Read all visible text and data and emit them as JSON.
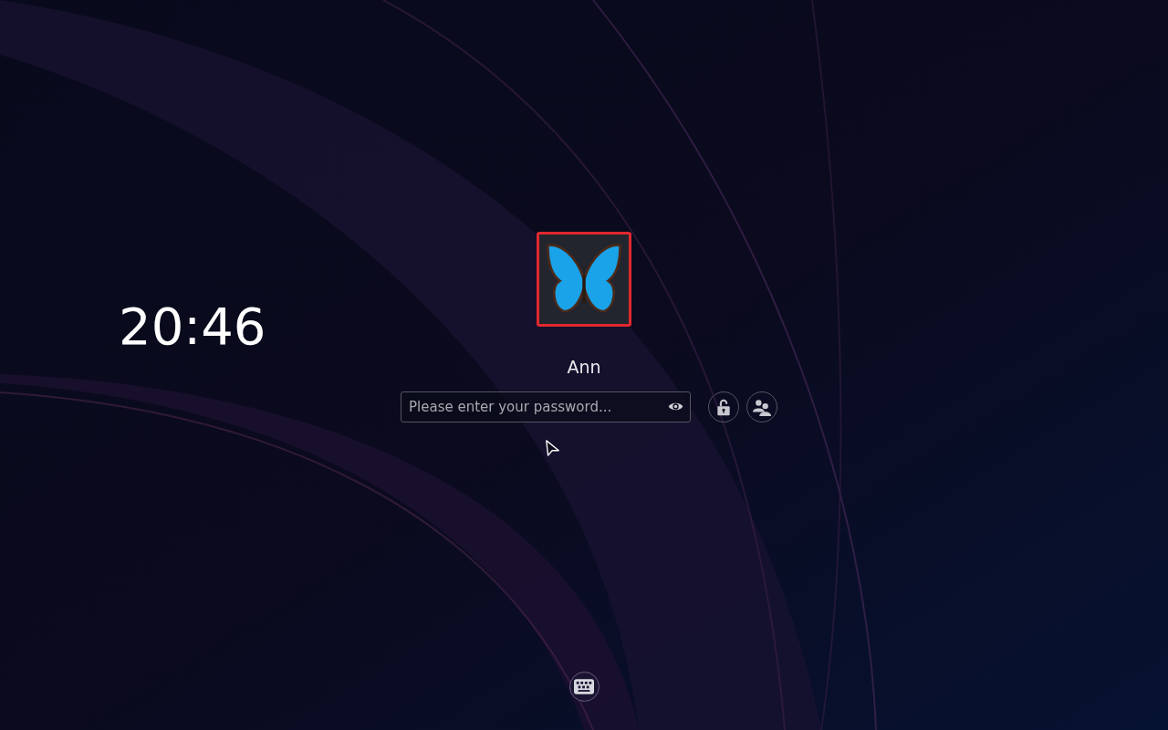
{
  "clock": {
    "time": "20:46"
  },
  "user": {
    "name": "Ann",
    "avatar_selected": true
  },
  "password_field": {
    "placeholder": "Please enter your password..."
  }
}
